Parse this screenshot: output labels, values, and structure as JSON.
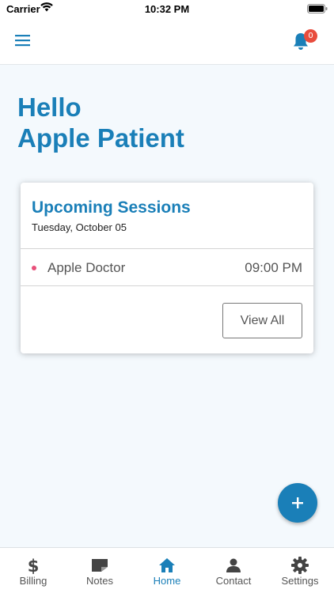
{
  "status_bar": {
    "carrier": "Carrier",
    "time": "10:32 PM"
  },
  "nav": {
    "menu_icon": "hamburger-menu-icon",
    "notifications_icon": "bell-icon",
    "notification_count": "0"
  },
  "greeting": {
    "line1": "Hello",
    "line2": "Apple Patient"
  },
  "upcoming": {
    "title": "Upcoming Sessions",
    "date": "Tuesday, October 05",
    "sessions": [
      {
        "doctor": "Apple Doctor",
        "time": "09:00 PM"
      }
    ],
    "view_all_label": "View All"
  },
  "fab": {
    "icon": "plus-icon"
  },
  "tabs": [
    {
      "label": "Billing",
      "icon": "dollar-icon",
      "active": false
    },
    {
      "label": "Notes",
      "icon": "note-icon",
      "active": false
    },
    {
      "label": "Home",
      "icon": "home-icon",
      "active": true
    },
    {
      "label": "Contact",
      "icon": "person-icon",
      "active": false
    },
    {
      "label": "Settings",
      "icon": "gear-icon",
      "active": false
    }
  ],
  "colors": {
    "primary": "#1a7fb8",
    "badge": "#e84c3d",
    "session_dot": "#e8507a",
    "background": "#f4f9fd"
  }
}
